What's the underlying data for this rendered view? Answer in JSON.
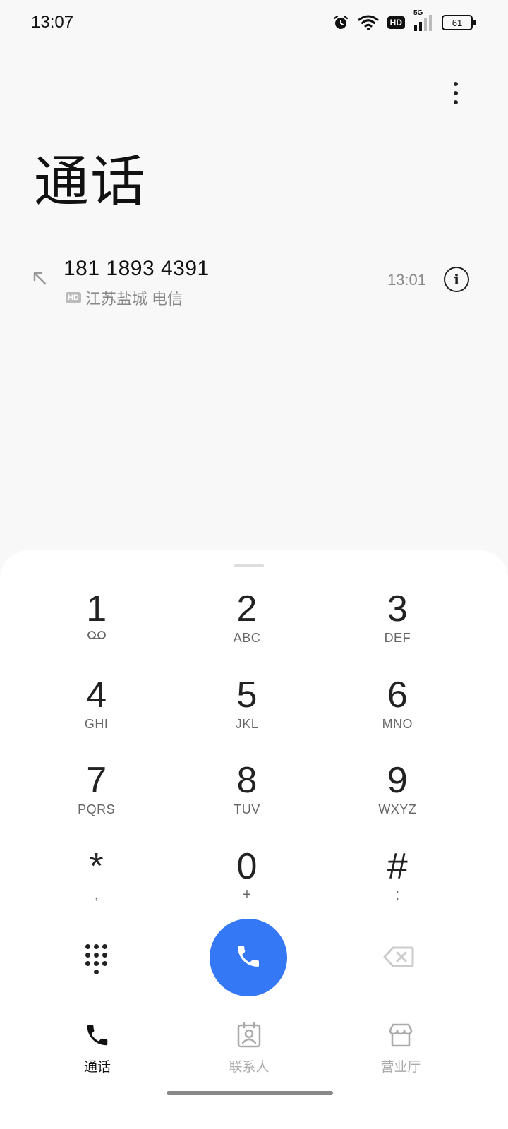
{
  "status_bar": {
    "time": "13:07",
    "network": "5G",
    "hd": "HD",
    "battery": "61",
    "icons": [
      "alarm-icon",
      "wifi-icon",
      "hd-icon",
      "signal-icon",
      "battery-icon"
    ]
  },
  "header": {
    "title": "通话",
    "menu_icon": "more-vertical-icon"
  },
  "call_log": [
    {
      "number": "181 1893 4391",
      "hd": "HD",
      "location": "江苏盐城 电信",
      "time": "13:01",
      "direction": "outgoing",
      "direction_icon": "outgoing-call-arrow-icon",
      "info_icon": "info-icon"
    }
  ],
  "keypad": {
    "keys": [
      {
        "digit": "1",
        "sub": "voicemail"
      },
      {
        "digit": "2",
        "sub": "ABC"
      },
      {
        "digit": "3",
        "sub": "DEF"
      },
      {
        "digit": "4",
        "sub": "GHI"
      },
      {
        "digit": "5",
        "sub": "JKL"
      },
      {
        "digit": "6",
        "sub": "MNO"
      },
      {
        "digit": "7",
        "sub": "PQRS"
      },
      {
        "digit": "8",
        "sub": "TUV"
      },
      {
        "digit": "9",
        "sub": "WXYZ"
      },
      {
        "digit": "*",
        "sub": ","
      },
      {
        "digit": "0",
        "sub": "+"
      },
      {
        "digit": "#",
        "sub": ";"
      }
    ]
  },
  "actions": {
    "keypad_toggle_icon": "dialpad-icon",
    "call_icon": "phone-icon",
    "call_color": "#3478f6",
    "backspace_icon": "backspace-icon"
  },
  "bottom_nav": {
    "items": [
      {
        "label": "通话",
        "icon": "phone-icon",
        "active": true
      },
      {
        "label": "联系人",
        "icon": "contacts-icon",
        "active": false
      },
      {
        "label": "营业厅",
        "icon": "store-icon",
        "active": false
      }
    ]
  }
}
